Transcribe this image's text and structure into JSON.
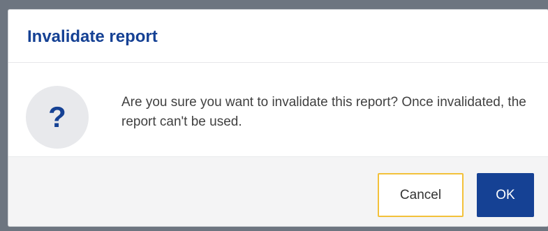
{
  "dialog": {
    "title": "Invalidate report",
    "icon": "question-icon",
    "icon_glyph": "?",
    "message": "Are you sure you want to invalidate this report? Once invalidated, the report can't be used.",
    "buttons": {
      "cancel_label": "Cancel",
      "ok_label": "OK"
    }
  },
  "colors": {
    "title": "#154194",
    "primary_button": "#154194",
    "cancel_focus_border": "#f3c13a",
    "icon_circle": "#e8e9ec",
    "footer_background": "#f4f4f5"
  }
}
